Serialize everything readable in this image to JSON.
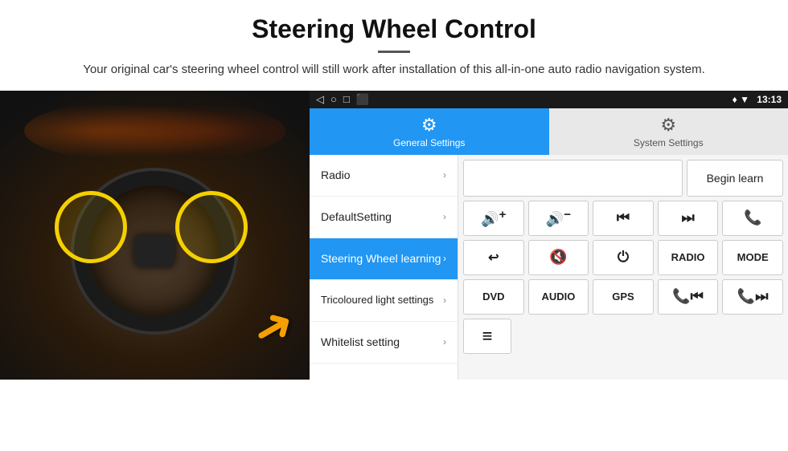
{
  "page": {
    "title": "Steering Wheel Control",
    "divider": true,
    "subtitle": "Your original car's steering wheel control will still work after installation of this all-in-one auto radio navigation system."
  },
  "status_bar": {
    "back_icon": "◁",
    "home_icon": "○",
    "recent_icon": "□",
    "screenshot_icon": "⬛",
    "gps_icon": "♦",
    "signal_icon": "▼",
    "time": "13:13"
  },
  "tabs": [
    {
      "id": "general",
      "label": "General Settings",
      "active": true
    },
    {
      "id": "system",
      "label": "System Settings",
      "active": false
    }
  ],
  "menu_items": [
    {
      "id": "radio",
      "label": "Radio",
      "active": false
    },
    {
      "id": "default",
      "label": "DefaultSetting",
      "active": false
    },
    {
      "id": "steering",
      "label": "Steering Wheel learning",
      "active": true
    },
    {
      "id": "tricoloured",
      "label": "Tricoloured light settings",
      "active": false
    },
    {
      "id": "whitelist",
      "label": "Whitelist setting",
      "active": false
    }
  ],
  "controls": {
    "begin_learn_label": "Begin learn",
    "row1": [
      {
        "id": "vol-up",
        "label": "🔊+",
        "text": "🔊+"
      },
      {
        "id": "vol-down",
        "label": "🔊−",
        "text": "🔊−"
      },
      {
        "id": "prev-track",
        "label": "⏮",
        "text": "⏮"
      },
      {
        "id": "next-track",
        "label": "⏭",
        "text": "⏭"
      },
      {
        "id": "phone",
        "label": "📞",
        "text": "📞"
      }
    ],
    "row2": [
      {
        "id": "hang-up",
        "label": "↩",
        "text": "↩"
      },
      {
        "id": "mute",
        "label": "🔇x",
        "text": "🔇"
      },
      {
        "id": "power",
        "label": "⏻",
        "text": "⏻"
      },
      {
        "id": "radio-btn",
        "label": "RADIO",
        "text": "RADIO"
      },
      {
        "id": "mode",
        "label": "MODE",
        "text": "MODE"
      }
    ],
    "row3": [
      {
        "id": "dvd",
        "label": "DVD",
        "text": "DVD"
      },
      {
        "id": "audio",
        "label": "AUDIO",
        "text": "AUDIO"
      },
      {
        "id": "gps",
        "label": "GPS",
        "text": "GPS"
      },
      {
        "id": "tel-prev",
        "label": "📞⏮",
        "text": "📞⏮"
      },
      {
        "id": "tel-next",
        "label": "📞⏭",
        "text": "📞⏭"
      }
    ],
    "row4_icon": "≡"
  }
}
